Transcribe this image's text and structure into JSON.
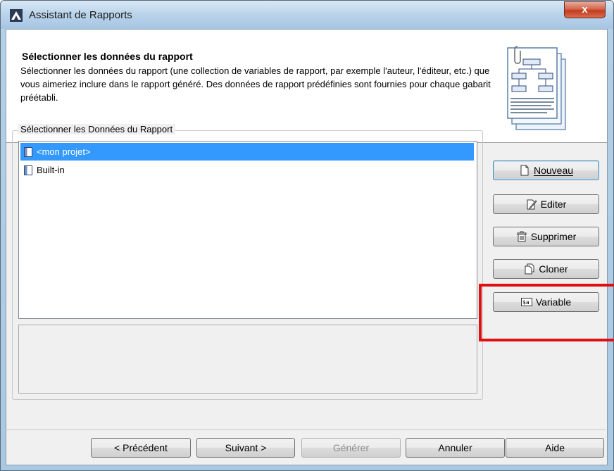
{
  "window": {
    "title": "Assistant de Rapports",
    "close_glyph": "x"
  },
  "header": {
    "title": "Sélectionner les données du rapport",
    "description": "Sélectionner les données du rapport (une collection de variables de rapport, par exemple l'auteur, l'éditeur, etc.) que vous aimeriez inclure dans le rapport généré. Des données de rapport prédéfinies sont fournies pour chaque gabarit préétabli."
  },
  "group": {
    "label": "Sélectionner les Données du Rapport",
    "items": [
      {
        "label": "<mon projet>",
        "selected": true
      },
      {
        "label": "Built-in",
        "selected": false
      }
    ]
  },
  "side_buttons": {
    "new": "Nouveau",
    "edit": "Editer",
    "delete": "Supprimer",
    "clone": "Cloner",
    "variable": "Variable"
  },
  "bottom_buttons": {
    "previous": "< Précédent",
    "next": "Suivant >",
    "generate": "Générer",
    "cancel": "Annuler",
    "help": "Aide"
  },
  "colors": {
    "selection": "#3399ff",
    "highlight": "#e01010"
  },
  "icons": {
    "title": "report-wizard-icon",
    "new": "new-document-icon",
    "edit": "edit-document-icon",
    "delete": "trash-icon",
    "clone": "clone-document-icon",
    "variable": "variable-icon",
    "list_item": "data-source-icon"
  }
}
